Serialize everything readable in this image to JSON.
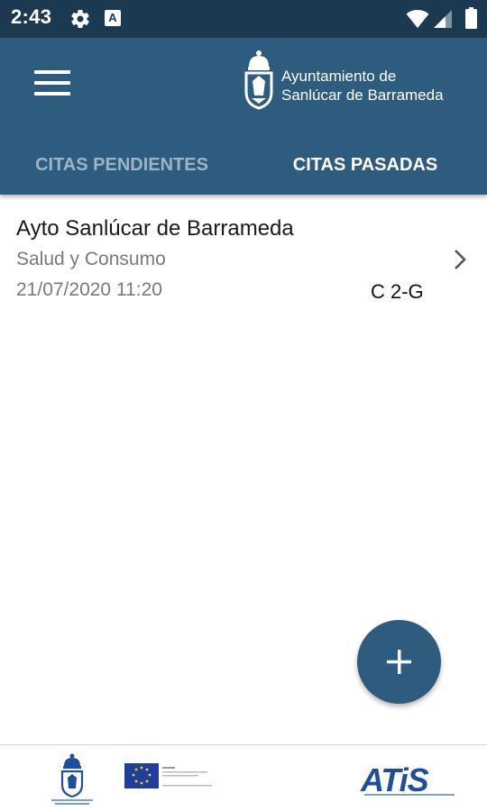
{
  "status_bar": {
    "time": "2:43",
    "a_badge": "A",
    "icons": [
      "gear-icon",
      "a-badge-icon",
      "wifi-icon",
      "signal-icon",
      "battery-icon"
    ]
  },
  "app_bar": {
    "logo_line1": "Ayuntamiento de",
    "logo_line2": "Sanlúcar de Barrameda"
  },
  "tabs": [
    {
      "label": "CITAS PENDIENTES",
      "active": false
    },
    {
      "label": "CITAS PASADAS",
      "active": true
    }
  ],
  "appointments": [
    {
      "title": "Ayto Sanlúcar de Barrameda",
      "service": "Salud y Consumo",
      "datetime": "21/07/2020 11:20",
      "code": "C 2-G"
    }
  ],
  "footer": {
    "atis_logo": "ATiS"
  },
  "colors": {
    "status_bar": "#1b3a52",
    "primary": "#2e5c7f",
    "tab_inactive": "#9db3c6",
    "atis_blue": "#1e4f9c"
  }
}
